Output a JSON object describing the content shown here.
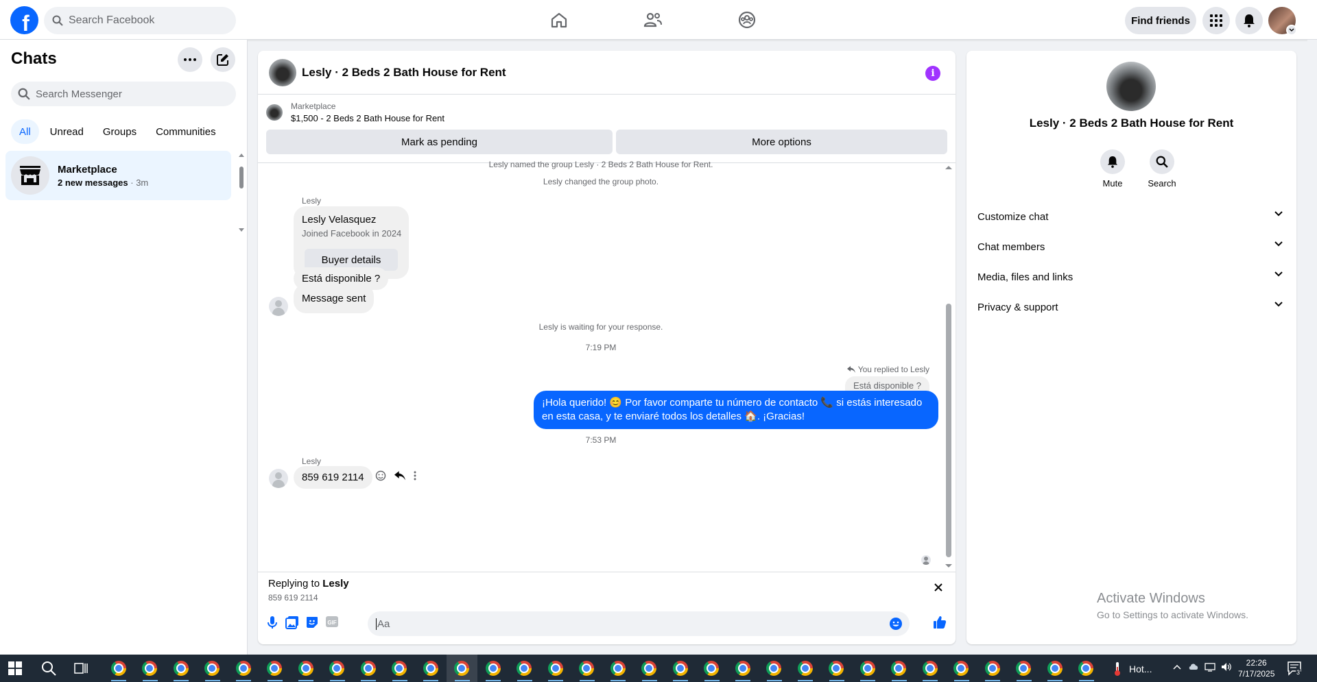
{
  "topbar": {
    "logo_letter": "f",
    "search_placeholder": "Search Facebook",
    "find_friends": "Find friends",
    "nav": [
      "home-icon",
      "friends-icon",
      "groups-icon"
    ]
  },
  "left": {
    "title": "Chats",
    "search_placeholder": "Search Messenger",
    "filters": [
      "All",
      "Unread",
      "Groups",
      "Communities"
    ],
    "chat": {
      "name": "Marketplace",
      "unread": "2 new messages",
      "sep": " · ",
      "time": "3m"
    }
  },
  "conversation": {
    "title": "Lesly · 2 Beds 2 Bath House for Rent",
    "marketplace_label": "Marketplace",
    "listing": "$1,500 - 2 Beds 2 Bath House for Rent",
    "mark_pending": "Mark as pending",
    "more_options": "More options",
    "sys_named": "Lesly named the group Lesly · 2 Beds 2 Bath House for Rent.",
    "sys_photo": "Lesly changed the group photo.",
    "sender_1": "Lesly",
    "card_name": "Lesly Velasquez",
    "card_joined": "Joined Facebook in 2024",
    "card_button": "Buyer details",
    "msg_available": "Está disponible ?",
    "msg_sent": "Message sent",
    "sys_waiting": "Lesly is waiting for your response.",
    "time_1": "7:19 PM",
    "replied_label": "You replied to Lesly",
    "replied_quote": "Está disponible ?",
    "out_message": "¡Hola querido! 😊 Por favor comparte tu número de contacto 📞 si estás interesado en esta casa, y te enviaré todos los detalles 🏠. ¡Gracias!",
    "time_2": "7:53 PM",
    "sender_2": "Lesly",
    "msg_phone": "859 619 2114",
    "replying_prefix": "Replying to ",
    "replying_name": "Lesly",
    "replying_text": "859 619 2114",
    "composer_placeholder": "Aa"
  },
  "info": {
    "title": "Lesly · 2 Beds 2 Bath House for Rent",
    "mute": "Mute",
    "search": "Search",
    "rows": [
      "Customize chat",
      "Chat members",
      "Media, files and links",
      "Privacy & support"
    ]
  },
  "watermark": {
    "line1": "Activate Windows",
    "line2": "Go to Settings to activate Windows."
  },
  "taskbar": {
    "weather": "Hot...",
    "time": "22:26",
    "date": "7/17/2025",
    "notif_count": "3"
  },
  "colors": {
    "accent": "#0866ff",
    "info_purple": "#a033ff"
  }
}
